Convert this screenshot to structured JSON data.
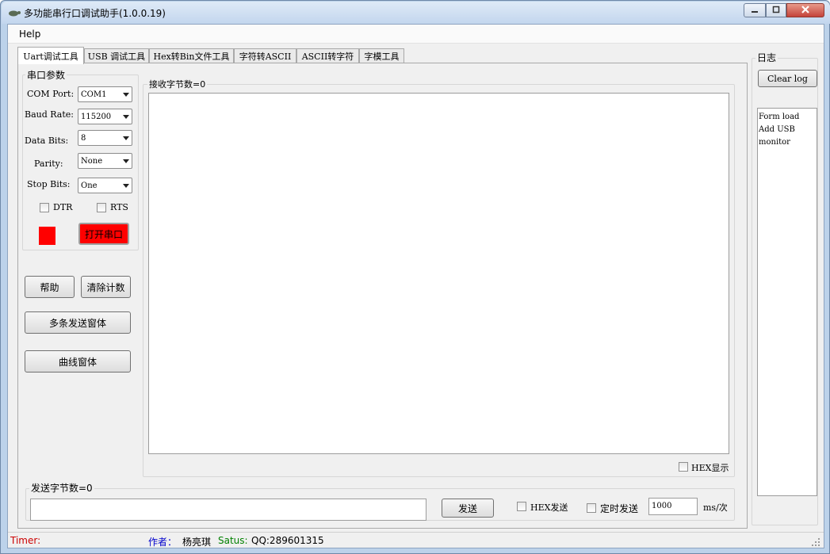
{
  "window": {
    "title": "多功能串行口调试助手(1.0.0.19)",
    "controls": {
      "minimize_icon": "minimize-icon",
      "maximize_icon": "maximize-icon",
      "close_icon": "close-icon"
    }
  },
  "menu": {
    "items": [
      "Help"
    ]
  },
  "tabs": [
    {
      "label": "Uart调试工具",
      "active": true
    },
    {
      "label": "USB 调试工具"
    },
    {
      "label": "Hex转Bin文件工具"
    },
    {
      "label": "字符转ASCII"
    },
    {
      "label": "ASCII转字符"
    },
    {
      "label": "字模工具"
    }
  ],
  "serial_params": {
    "group_label": "串口参数",
    "com_port": {
      "label": "COM Port:",
      "value": "COM1"
    },
    "baud_rate": {
      "label": "Baud Rate:",
      "value": "115200"
    },
    "data_bits": {
      "label": "Data Bits:",
      "value": "8"
    },
    "parity": {
      "label": "Parity:",
      "value": "None"
    },
    "stop_bits": {
      "label": "Stop Bits:",
      "value": "One"
    },
    "dtr_label": "DTR",
    "rts_label": "RTS",
    "status_color": "#ff0000",
    "open_button": "打开串口"
  },
  "buttons": {
    "help": "帮助",
    "clear_count": "清除计数",
    "multi_send": "多条发送窗体",
    "curve": "曲线窗体"
  },
  "receive": {
    "label": "接收字节数=0",
    "hex_display_label": "HEX显示"
  },
  "send": {
    "label": "发送字节数=0",
    "input_value": "",
    "send_button": "发送",
    "hex_send_label": "HEX发送",
    "timed_send_label": "定时发送",
    "interval_value": "1000",
    "interval_unit": "ms/次"
  },
  "log": {
    "group_label": "日志",
    "clear_button": "Clear log",
    "lines": [
      "Form load",
      "Add USB",
      "monitor"
    ]
  },
  "status": {
    "timer_label": "Timer:",
    "author_label": "作者：",
    "author_name": "杨亮琪",
    "satus_label": "Satus:",
    "qq": "QQ:289601315",
    "timer_color": "#cc0000",
    "author_color": "#0000cc",
    "satus_color": "#008000"
  }
}
